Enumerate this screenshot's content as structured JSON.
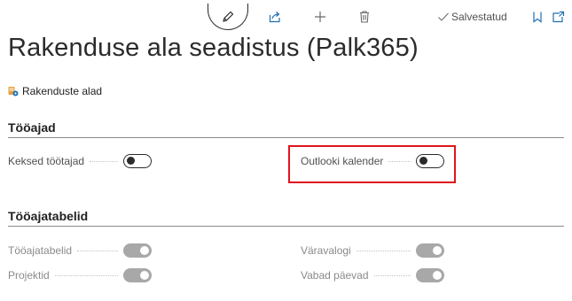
{
  "toolbar": {
    "edit_icon": "pencil-icon",
    "share_icon": "share-icon",
    "new_icon": "plus-icon",
    "delete_icon": "trash-icon",
    "saved_label": "Salvestatud",
    "bookmark_icon": "bookmark-icon",
    "popout_icon": "open-in-new-window-icon"
  },
  "page": {
    "title": "Rakenduse ala seadistus (Palk365)"
  },
  "actions": {
    "app_areas_label": "Rakenduste alad",
    "app_areas_icon": "app-areas-icon"
  },
  "sections": {
    "time": {
      "title": "Tööajad",
      "fields": [
        {
          "label": "Keksed töötajad",
          "value": false
        },
        {
          "label": "Outlooki kalender",
          "value": false
        }
      ]
    },
    "timesheets": {
      "title": "Tööajatabelid",
      "fields": [
        {
          "label": "Tööajatabelid",
          "value": true
        },
        {
          "label": "Väravalogi",
          "value": true
        },
        {
          "label": "Projektid",
          "value": true
        },
        {
          "label": "Vabad päevad",
          "value": true
        }
      ]
    }
  },
  "colors": {
    "accent": "#1f6fb5",
    "highlight": "#e0141e",
    "toggle_disabled_on": "#a8a8a8"
  }
}
